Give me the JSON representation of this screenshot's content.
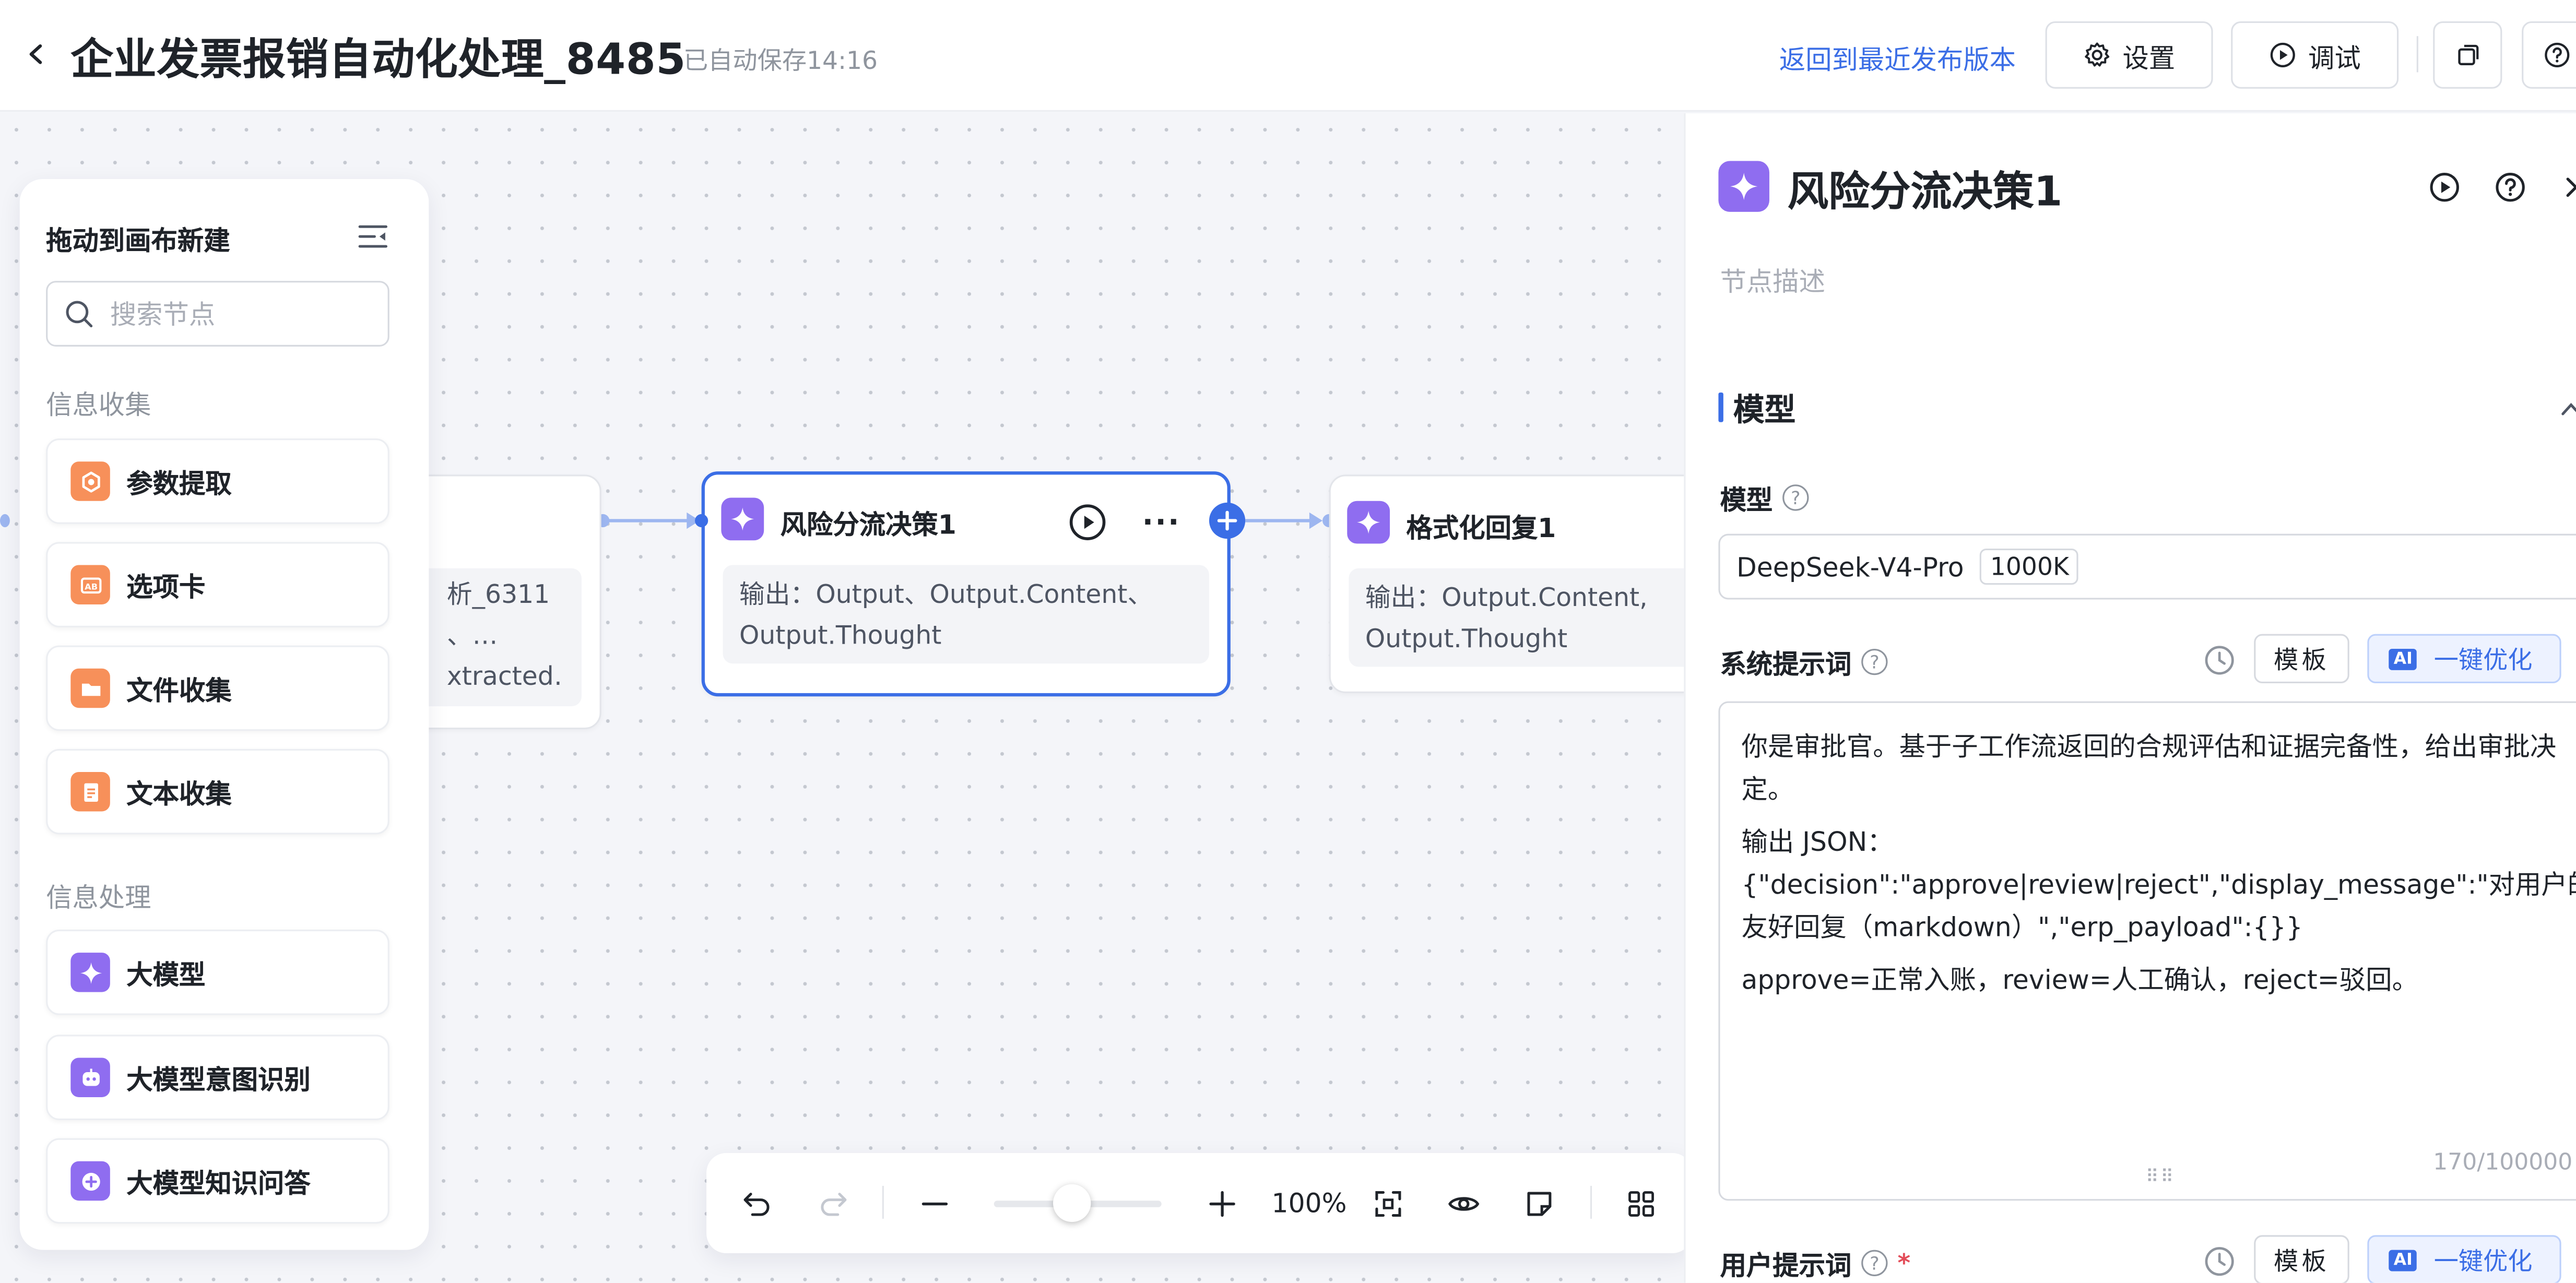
{
  "header": {
    "title": "企业发票报销自动化处理_8485",
    "autosave": "已自动保存14:16",
    "revert_label": "返回到最近发布版本",
    "settings_label": "设置",
    "debug_label": "调试"
  },
  "canvas": {
    "prev_node": {
      "output_lines": [
        "析_6311",
        "、…",
        "xtracted…"
      ]
    },
    "main_node": {
      "title": "风险分流决策1",
      "output": "输出：Output、Output.Content、Output.Thought"
    },
    "next_node": {
      "title": "格式化回复1",
      "output": "输出：Output.Content, Output.Thought"
    }
  },
  "node_panel": {
    "title": "拖动到画布新建",
    "search_placeholder": "搜索节点",
    "sections": [
      {
        "label": "信息收集",
        "items": [
          {
            "label": "参数提取",
            "icon": "extract-icon",
            "color": "#f7905a"
          },
          {
            "label": "选项卡",
            "icon": "option-card-icon",
            "color": "#f7905a"
          },
          {
            "label": "文件收集",
            "icon": "folder-icon",
            "color": "#f7905a"
          },
          {
            "label": "文本收集",
            "icon": "text-doc-icon",
            "color": "#f7905a"
          }
        ]
      },
      {
        "label": "信息处理",
        "items": [
          {
            "label": "大模型",
            "icon": "sparkle-icon",
            "color": "#8f6df0"
          },
          {
            "label": "大模型意图识别",
            "icon": "robot-icon",
            "color": "#8f6df0"
          },
          {
            "label": "大模型知识问答",
            "icon": "knowledge-icon",
            "color": "#8f6df0"
          }
        ]
      }
    ]
  },
  "toolbar": {
    "zoom": "100%"
  },
  "side_panel": {
    "title": "风险分流决策1",
    "description_placeholder": "节点描述",
    "section_title": "模型",
    "model_label": "模型",
    "model_name": "DeepSeek-V4-Pro",
    "model_ctx": "1000K",
    "system_prompt_label": "系统提示词",
    "template_label": "模板",
    "ai_badge": "AI",
    "optimize_label": "一键优化",
    "system_prompt_lines": [
      "你是审批官。基于子工作流返回的合规评估和证据完备性，给出审批决定。",
      "输出 JSON：{\"decision\":\"approve|review|reject\",\"display_message\":\"对用户的友好回复（markdown）\",\"erp_payload\":{}}",
      "approve=正常入账，review=人工确认，reject=驳回。"
    ],
    "char_count": "170/100000",
    "user_prompt_label": "用户提示词",
    "required_mark": "*"
  },
  "colors": {
    "accent": "#3b6ee6",
    "llm_purple": "#8f6df0",
    "collect_orange": "#f7905a"
  }
}
